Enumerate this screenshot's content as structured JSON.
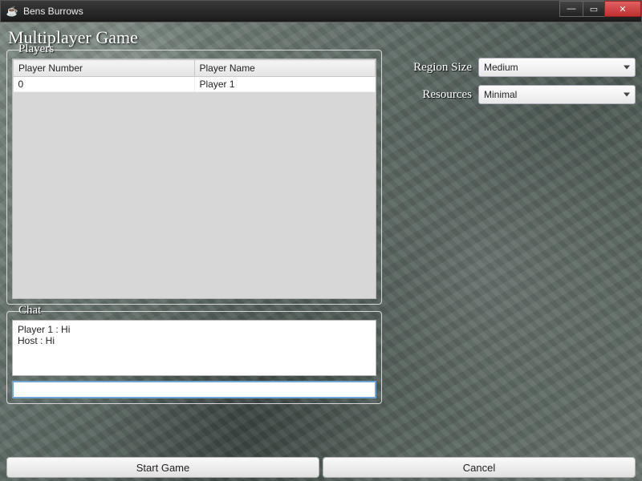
{
  "window": {
    "title": "Bens Burrows"
  },
  "heading": "Multiplayer Game",
  "players_panel": {
    "legend": "Players",
    "columns": {
      "number": "Player Number",
      "name": "Player Name"
    },
    "rows": [
      {
        "number": "0",
        "name": "Player 1"
      }
    ]
  },
  "chat_panel": {
    "legend": "Chat",
    "messages": [
      "Player 1 : Hi",
      "Host : Hi"
    ],
    "input_value": ""
  },
  "settings": {
    "region_size": {
      "label": "Region Size",
      "value": "Medium"
    },
    "resources": {
      "label": "Resources",
      "value": "Minimal"
    }
  },
  "buttons": {
    "start": "Start Game",
    "cancel": "Cancel"
  }
}
